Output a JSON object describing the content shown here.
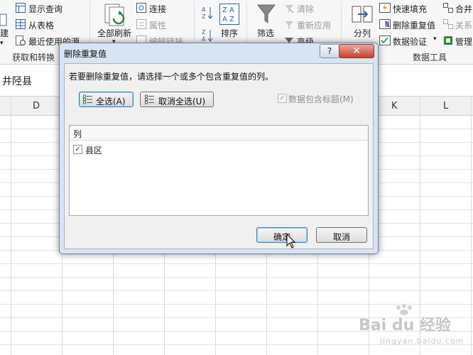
{
  "ribbon": {
    "left_group": {
      "items": [
        "显示查询",
        "从表格",
        "最近使用的源"
      ],
      "new_query_partial": "建",
      "label": "获取和转换"
    },
    "connections": {
      "refresh_all": "全部刷新",
      "items": [
        "连接",
        "属性",
        "编辑链接"
      ]
    },
    "sort": {
      "sort_label": "排序",
      "az_glyph": "A↓Z"
    },
    "filter": {
      "filter_label": "筛选",
      "items": [
        "清除",
        "重新应用",
        "高级"
      ]
    },
    "data_tools": {
      "split_label": "分列",
      "items": [
        "快速填充",
        "删除重复值",
        "数据验证"
      ],
      "label": "数据工具",
      "merge_partial": "合并",
      "relation_partial": "关系",
      "manage_partial": "管理"
    }
  },
  "formula_bar": {
    "value": "井陉县"
  },
  "columns": {
    "d": "D",
    "k": "K",
    "l": "L"
  },
  "dialog": {
    "title": "删除重复值",
    "help": "?",
    "close": "✕",
    "instruction": "若要删除重复值，请选择一个或多个包含重复值的列。",
    "select_all": "全选(A)",
    "unselect_all": "取消全选(U)",
    "header_checkbox_label": "数据包含标题(M)",
    "header_checkbox_checked": true,
    "list_header": "列",
    "columns": [
      {
        "label": "县区",
        "checked": true
      }
    ],
    "ok": "确定",
    "cancel": "取消"
  },
  "watermark": {
    "main": "Bai du 经验",
    "sub": "jingyan.baidu.com"
  },
  "colors": {
    "dialog_frame": "#d7e4f2",
    "close_red": "#c8412f",
    "ribbon_bg": "#f7f7f7"
  }
}
